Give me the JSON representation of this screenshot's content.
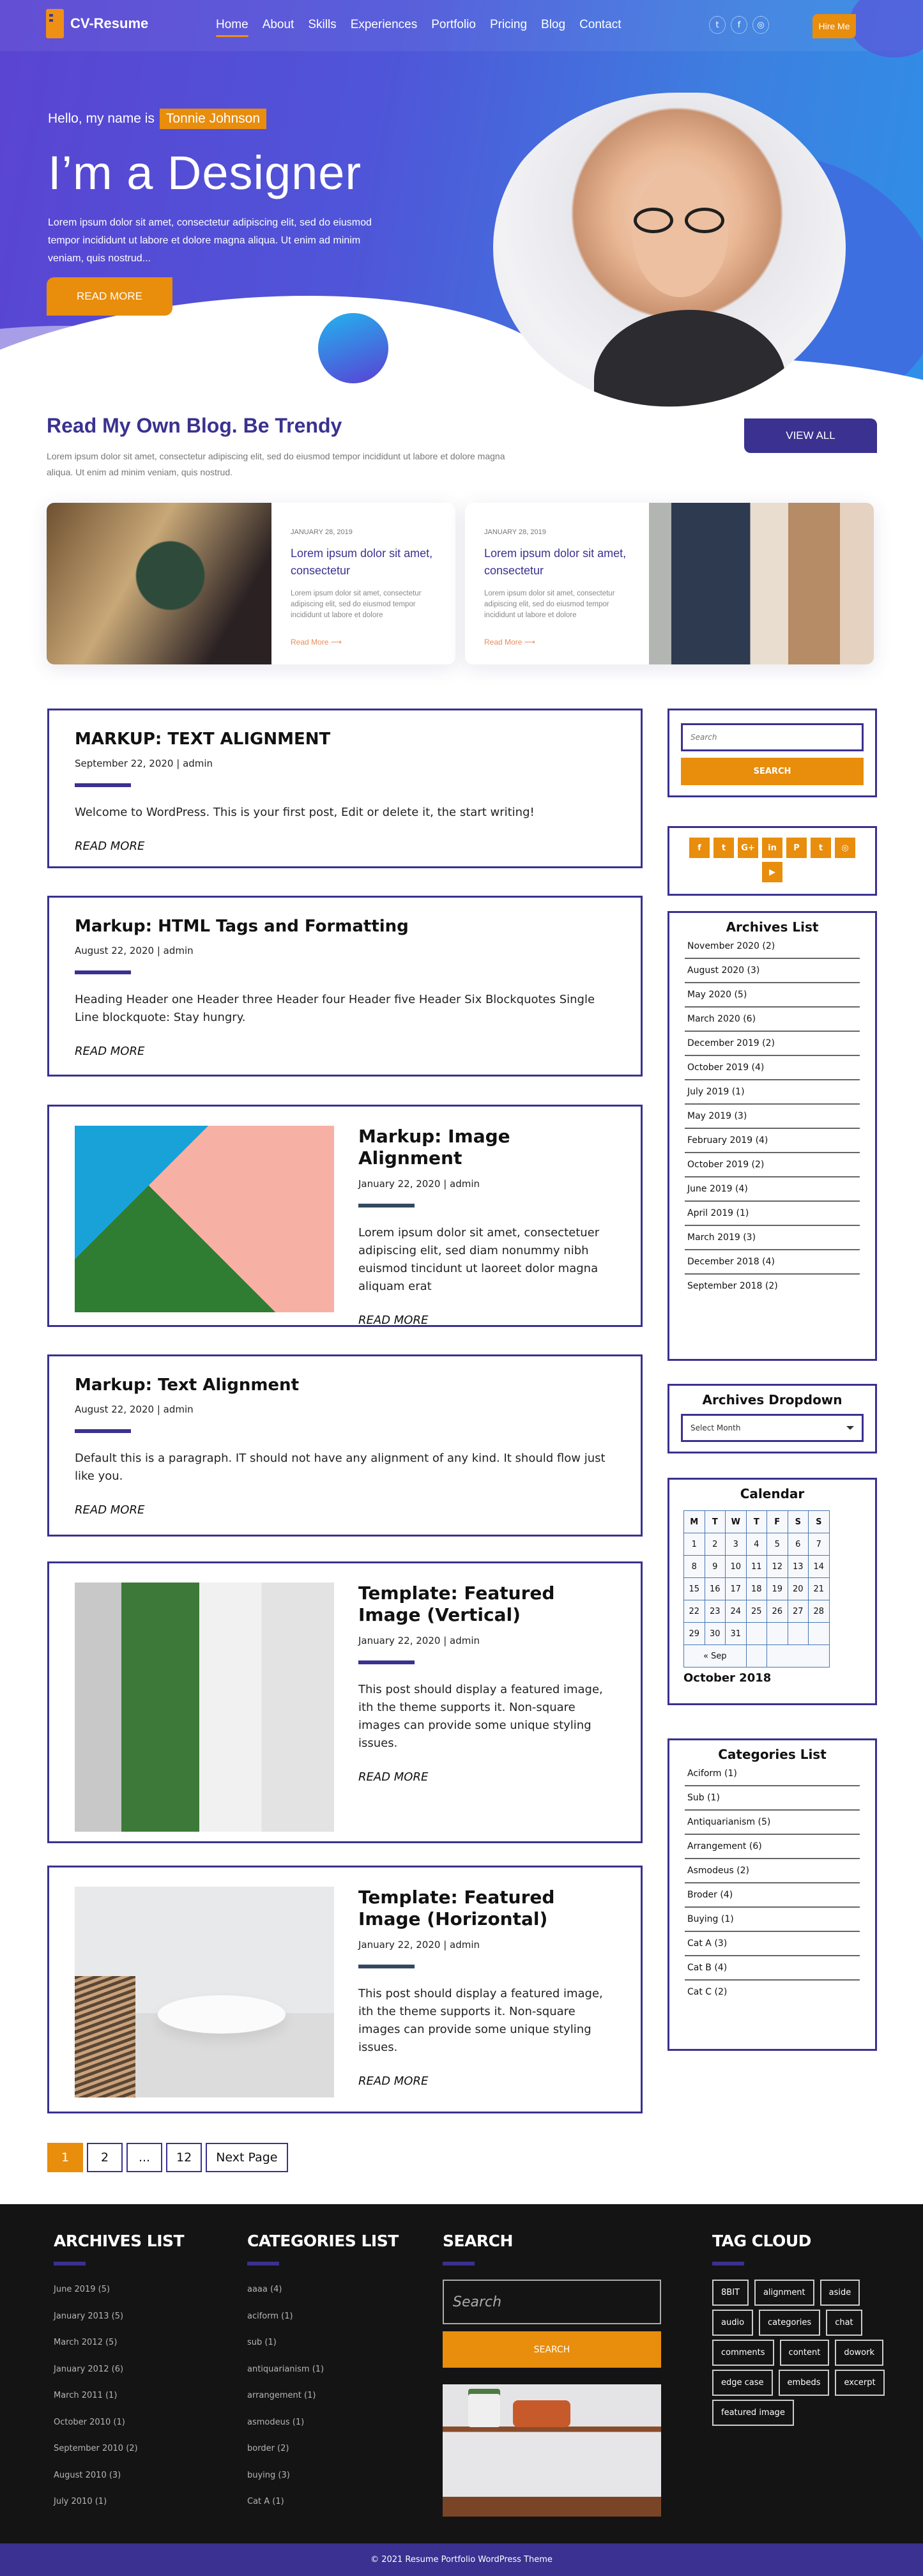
{
  "header": {
    "logo_text": "CV-Resume",
    "nav": [
      {
        "label": "Home",
        "active": true
      },
      {
        "label": "About"
      },
      {
        "label": "Skills"
      },
      {
        "label": "Experiences"
      },
      {
        "label": "Portfolio"
      },
      {
        "label": "Pricing"
      },
      {
        "label": "Blog"
      },
      {
        "label": "Contact"
      }
    ],
    "social_icons": [
      "twitter-icon",
      "facebook-icon",
      "instagram-icon"
    ],
    "social_glyphs": [
      "t",
      "f",
      "◎"
    ],
    "hire_label": "Hire Me"
  },
  "hero": {
    "hello": "Hello, my name is",
    "name": "Tonnie Johnson",
    "title": "I’m a Designer",
    "description": "Lorem ipsum dolor sit amet, consectetur adipiscing elit, sed do eiusmod tempor incididunt ut labore et dolore magna aliqua. Ut enim ad minim veniam, quis nostrud...",
    "button": "READ MORE"
  },
  "blog_intro": {
    "heading": "Read My Own Blog. Be Trendy",
    "subtitle": "Lorem ipsum dolor sit amet, consectetur adipiscing elit, sed do eiusmod tempor incididunt ut labore et dolore magna aliqua. Ut enim ad minim veniam, quis nostrud.",
    "view_all": "VIEW ALL"
  },
  "featured_posts": [
    {
      "date": "JANUARY 28, 2019",
      "title": "Lorem ipsum dolor sit amet, consectetur",
      "excerpt": "Lorem ipsum dolor sit amet, consectetur adipiscing elit, sed do eiusmod tempor incididunt ut labore et dolore",
      "read_more": "Read More  ⟶"
    },
    {
      "date": "JANUARY 28, 2019",
      "title": "Lorem ipsum dolor sit amet, consectetur",
      "excerpt": "Lorem ipsum dolor sit amet, consectetur adipiscing elit, sed do eiusmod tempor incididunt ut labore et dolore",
      "read_more": "Read More  ⟶"
    }
  ],
  "posts": [
    {
      "title": "MARKUP: TEXT ALIGNMENT",
      "meta": "September 22, 2020 | admin",
      "text": "Welcome to WordPress. This is your first post, Edit or delete it, the start writing!",
      "read_more": "READ MORE"
    },
    {
      "title": "Markup: HTML Tags and Formatting",
      "meta": "August 22, 2020 | admin",
      "text": "Heading Header one Header three Header four Header five Header Six Blockquotes Single Line blockquote: Stay hungry.",
      "read_more": "READ MORE"
    },
    {
      "title": "Markup: Image Alignment",
      "meta": "January 22, 2020 | admin",
      "text": "Lorem ipsum dolor sit amet, consectetuer adipiscing elit, sed diam nonummy nibh euismod tincidunt ut laoreet dolor magna aliquam erat",
      "read_more": "READ MORE"
    },
    {
      "title": "Markup: Text Alignment",
      "meta": "August 22, 2020 | admin",
      "text": "Default this is a paragraph. IT should not have any alignment of any kind. It should flow just like you.",
      "read_more": "READ MORE"
    },
    {
      "title": "Template: Featured Image (Vertical)",
      "meta": "January 22, 2020 | admin",
      "text": "This post should display a featured image, ith the theme supports it. Non-square images can provide some unique styling issues.",
      "read_more": "READ MORE"
    },
    {
      "title": "Template: Featured Image (Horizontal)",
      "meta": "January 22, 2020 | admin",
      "text": "This post should display a featured image, ith the theme supports it. Non-square images can provide some unique styling issues.",
      "read_more": "READ MORE"
    }
  ],
  "pagination": {
    "pages": [
      "1",
      "2",
      "...",
      "12"
    ],
    "current": "1",
    "next": "Next Page"
  },
  "sidebar": {
    "search": {
      "placeholder": "Search",
      "button": "SEARCH"
    },
    "social": [
      {
        "icon": "facebook-icon",
        "glyph": "f"
      },
      {
        "icon": "twitter-icon",
        "glyph": "t"
      },
      {
        "icon": "google-plus-icon",
        "glyph": "G+"
      },
      {
        "icon": "linkedin-icon",
        "glyph": "in"
      },
      {
        "icon": "pinterest-icon",
        "glyph": "P"
      },
      {
        "icon": "tumblr-icon",
        "glyph": "t"
      },
      {
        "icon": "instagram-icon",
        "glyph": "◎"
      },
      {
        "icon": "youtube-icon",
        "glyph": "▶"
      }
    ],
    "archives_title": "Archives List",
    "archives": [
      "November 2020 (2)",
      "August 2020 (3)",
      "May 2020 (5)",
      "March 2020 (6)",
      "December 2019 (2)",
      "October 2019 (4)",
      "July 2019 (1)",
      "May 2019 (3)",
      "February 2019 (4)",
      "October 2019 (2)",
      "June 2019 (4)",
      "April 2019 (1)",
      "March 2019 (3)",
      "December 2018 (4)",
      "September 2018 (2)"
    ],
    "dropdown_title": "Archives Dropdown",
    "dropdown_value": "Select Month",
    "calendar": {
      "title": "Calendar",
      "weekdays": [
        "M",
        "T",
        "W",
        "T",
        "F",
        "S",
        "S"
      ],
      "weeks": [
        [
          "1",
          "2",
          "3",
          "4",
          "5",
          "6",
          "7"
        ],
        [
          "8",
          "9",
          "10",
          "11",
          "12",
          "13",
          "14"
        ],
        [
          "15",
          "16",
          "17",
          "18",
          "19",
          "20",
          "21"
        ],
        [
          "22",
          "23",
          "24",
          "25",
          "26",
          "27",
          "28"
        ],
        [
          "29",
          "30",
          "31",
          "",
          "",
          "",
          ""
        ]
      ],
      "prev": "« Sep",
      "caption": "October 2018"
    },
    "categories_title": "Categories List",
    "categories": [
      "Aciform (1)",
      "Sub (1)",
      "Antiquarianism (5)",
      "Arrangement (6)",
      "Asmodeus (2)",
      "Broder (4)",
      "Buying (1)",
      "Cat A (3)",
      "Cat B (4)",
      "Cat C (2)"
    ]
  },
  "footer": {
    "archives_title": "ARCHIVES LIST",
    "archives": [
      "June 2019 (5)",
      "January  2013 (5)",
      "March 2012 (5)",
      "January  2012 (6)",
      "March  2011 (1)",
      "October 2010 (1)",
      "September 2010 (2)",
      "August 2010 (3)",
      "July 2010 (1)"
    ],
    "categories_title": "CATEGORIES LIST",
    "categories": [
      "aaaa (4)",
      "aciform (1)",
      "sub (1)",
      "antiquarianism (1)",
      "arrangement (1)",
      "asmodeus (1)",
      "border (2)",
      "buying (3)",
      "Cat A (1)"
    ],
    "search_title": "SEARCH",
    "search_placeholder": "Search",
    "search_button": "SEARCH",
    "tagcloud_title": "TAG CLOUD",
    "tags": [
      "8BIT",
      "alignment",
      "aside",
      "audio",
      "categories",
      "chat",
      "comments",
      "content",
      "dowork",
      "edge case",
      "embeds",
      "excerpt",
      "featured image"
    ],
    "copyright": "© 2021 Resume Portfolio WordPress Theme"
  }
}
